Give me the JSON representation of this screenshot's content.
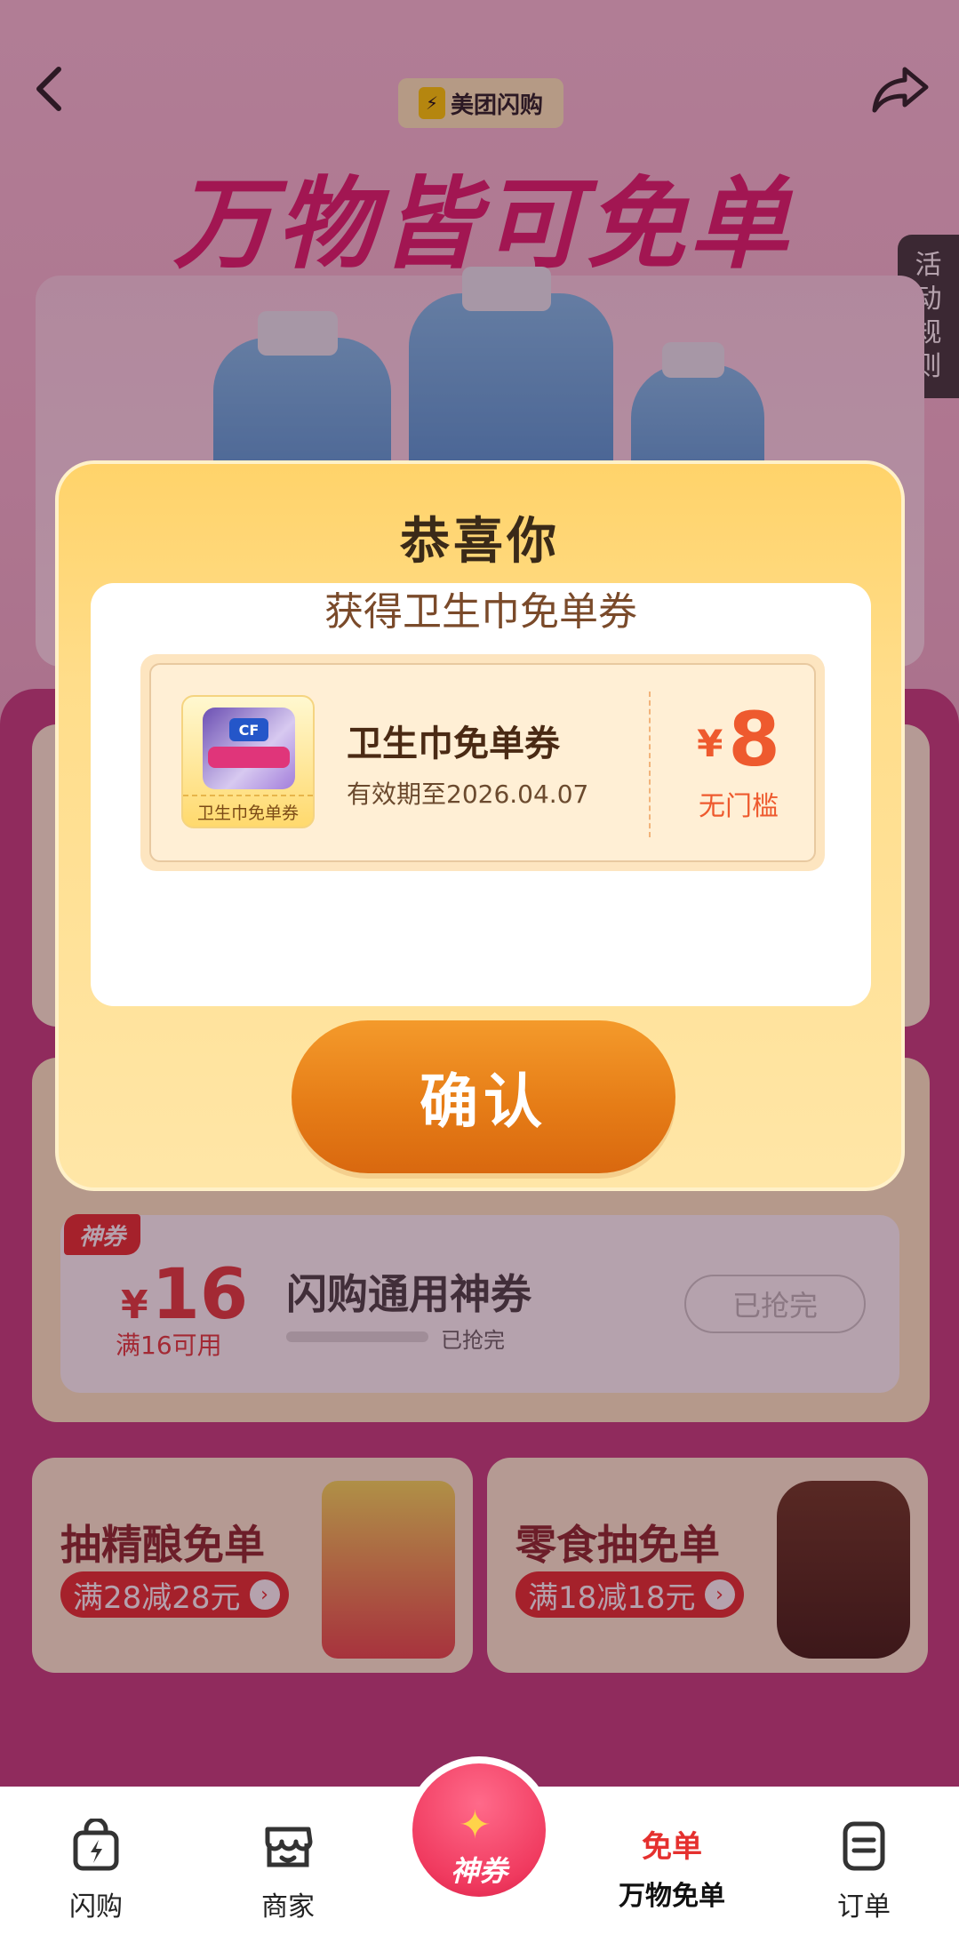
{
  "header": {
    "brand": "美团闪购",
    "hero_title": "万物皆可免单",
    "rule_tab": "活动规则"
  },
  "background": {
    "shenquan_tag": "神券",
    "coupon_currency": "¥",
    "coupon_amount": "16",
    "coupon_condition": "满16可用",
    "coupon_name": "闪购通用神券",
    "coupon_status": "已抢完",
    "coupon_button": "已抢完",
    "promos": [
      {
        "title": "抽精酿免单",
        "badge": "满28减28元"
      },
      {
        "title": "零食抽免单",
        "badge": "满18减18元"
      }
    ]
  },
  "modal": {
    "title": "恭喜你",
    "subtitle": "获得卫生巾免单券",
    "coupon": {
      "thumb_label": "卫生巾免单券",
      "name": "卫生巾免单券",
      "expiry": "有效期至2026.04.07",
      "currency": "¥",
      "amount": "8",
      "condition": "无门槛"
    },
    "confirm_label": "确认"
  },
  "tabbar": {
    "items": [
      {
        "label": "闪购",
        "icon": "shopping-bag-icon"
      },
      {
        "label": "商家",
        "icon": "store-icon"
      },
      {
        "label": "神券",
        "icon": "coupon-gift-icon"
      },
      {
        "label": "万物免单",
        "badge": "免单",
        "active": true
      },
      {
        "label": "订单",
        "icon": "order-list-icon"
      }
    ]
  },
  "colors": {
    "accent_red": "#e5302e",
    "modal_yellow": "#ffd36a",
    "confirm_orange": "#e67d17",
    "hero_pink": "#e01d6c"
  }
}
